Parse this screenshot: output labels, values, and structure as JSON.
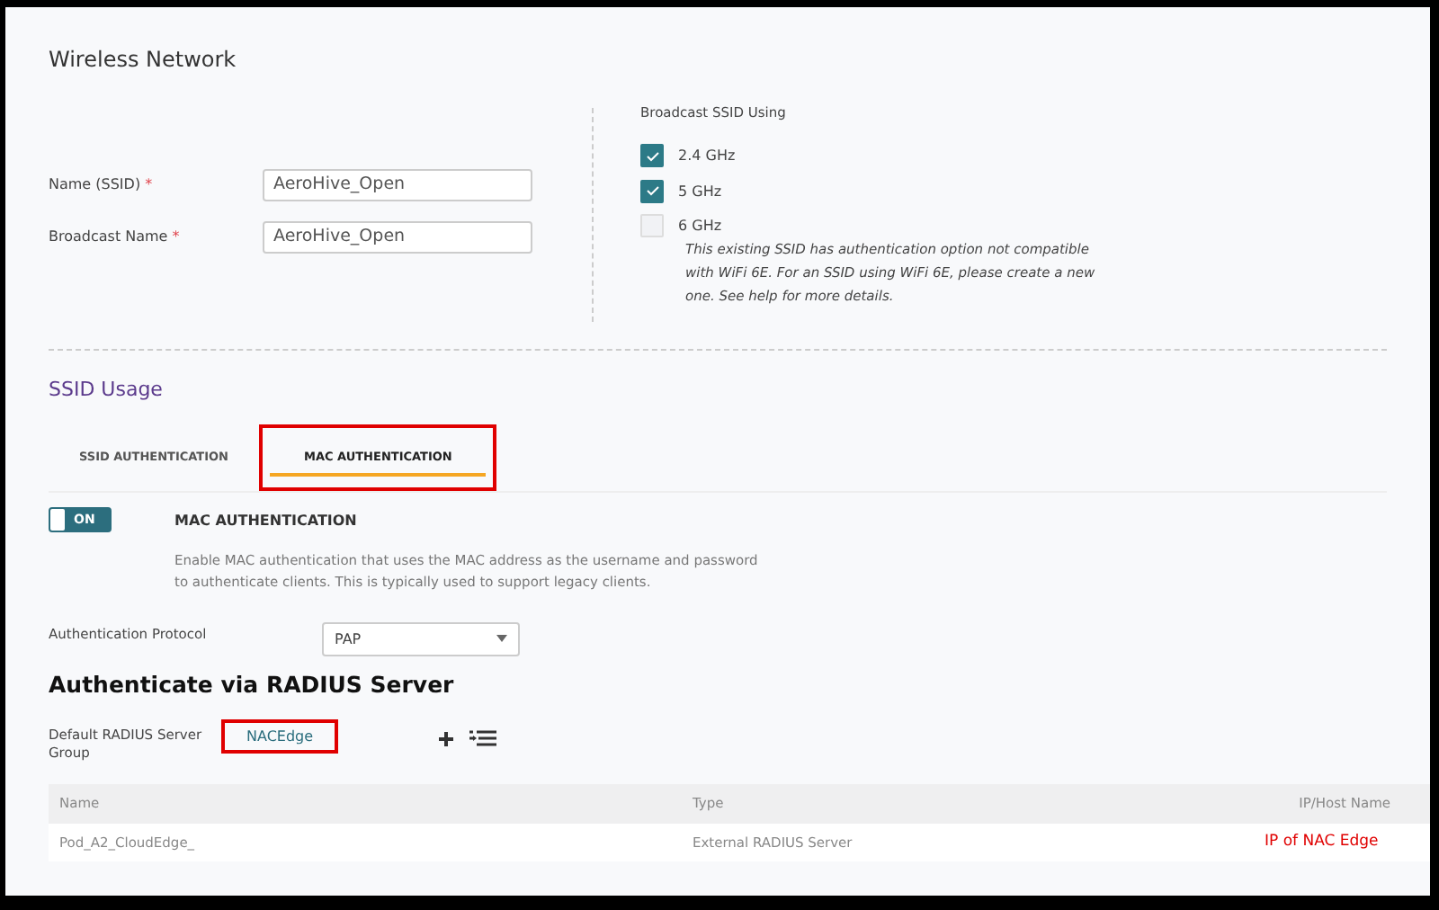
{
  "wireless_network": {
    "title": "Wireless Network",
    "fields": [
      {
        "label": "Name (SSID)",
        "required_mark": "*",
        "value": "AeroHive_Open"
      },
      {
        "label": "Broadcast Name",
        "required_mark": "*",
        "value": "AeroHive_Open"
      }
    ],
    "broadcast": {
      "label": "Broadcast SSID Using",
      "bands": [
        {
          "label": "2.4 GHz",
          "checked": true
        },
        {
          "label": "5 GHz",
          "checked": true
        },
        {
          "label": "6 GHz",
          "checked": false
        }
      ],
      "note": "This existing SSID has authentication option not compatible with WiFi 6E. For an SSID using WiFi 6E, please create a new one. See help for more details."
    }
  },
  "ssid_usage": {
    "title": "SSID Usage",
    "tabs": [
      {
        "label": "SSID AUTHENTICATION",
        "selected": false,
        "highlighted": false
      },
      {
        "label": "MAC AUTHENTICATION",
        "selected": true,
        "highlighted": true
      }
    ],
    "mac_auth": {
      "toggle": {
        "on": true,
        "label": "ON"
      },
      "title": "MAC AUTHENTICATION",
      "description": "Enable MAC authentication that uses the MAC address as the username and password to authenticate clients. This is typically used to support legacy clients."
    },
    "protocol": {
      "label": "Authentication Protocol",
      "value": "PAP"
    }
  },
  "radius": {
    "title": "Authenticate via RADIUS Server",
    "group": {
      "label": "Default RADIUS Server Group",
      "value": "NACEdge",
      "highlighted": true
    },
    "table": {
      "columns": [
        "Name",
        "Type",
        "IP/Host Name"
      ],
      "rows": [
        [
          "Pod_A2_CloudEdge_",
          "External RADIUS Server",
          "IP of NAC Edge"
        ]
      ]
    }
  }
}
